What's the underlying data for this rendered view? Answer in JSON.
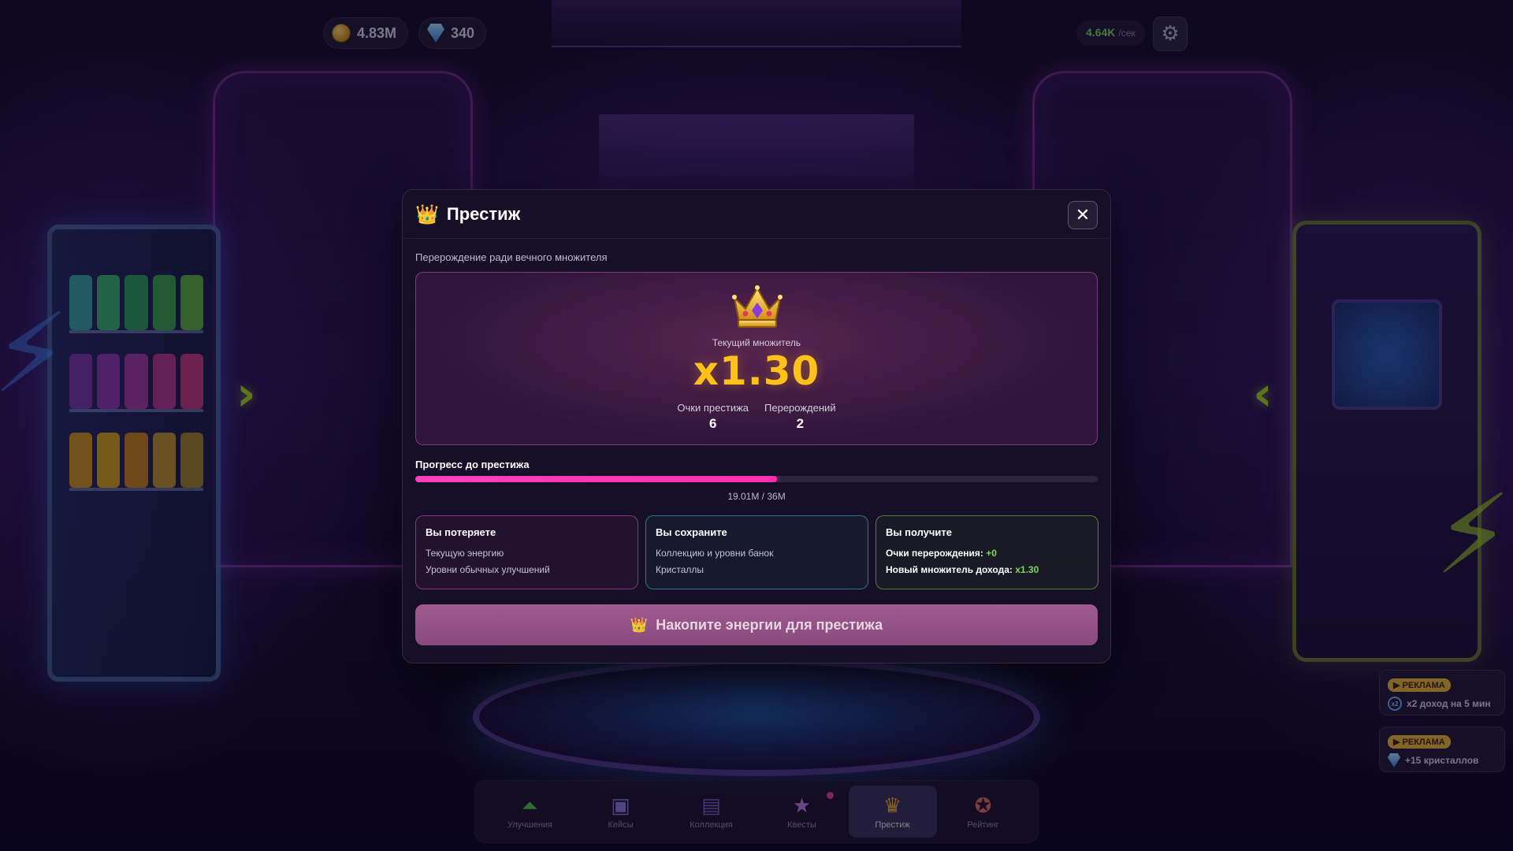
{
  "hud": {
    "coins": "4.83M",
    "crystals": "340",
    "rate_value": "4.64K",
    "rate_unit": "/сек"
  },
  "modal": {
    "title": "Престиж",
    "subtitle": "Перерождение ради вечного множителя",
    "multiplier_label": "Текущий множитель",
    "multiplier_value": "x1.30",
    "stats": [
      {
        "label": "Очки престижа",
        "value": "6"
      },
      {
        "label": "Перерождений",
        "value": "2"
      }
    ],
    "progress": {
      "title": "Прогресс до престижа",
      "text": "19.01M / 36M",
      "fraction": 0.53
    },
    "lose": {
      "title": "Вы потеряете",
      "items": [
        "Текущую энергию",
        "Уровни обычных улучшений"
      ]
    },
    "keep": {
      "title": "Вы сохраните",
      "items": [
        "Коллекцию и уровни банок",
        "Кристаллы"
      ]
    },
    "gain": {
      "title": "Вы получите",
      "points_label": "Очки перерождения:",
      "points_value": "+0",
      "mult_label": "Новый множитель дохода:",
      "mult_value": "x1.30"
    },
    "button_label": "Накопите энергии для престижа"
  },
  "ads": [
    {
      "badge": "▶ РЕКЛАМА",
      "text": "x2 доход на 5 мин",
      "icon": "x2-boost-icon"
    },
    {
      "badge": "▶ РЕКЛАМА",
      "text": "+15 кристаллов",
      "icon": "crystal-icon"
    }
  ],
  "nav": [
    {
      "label": "Улучшения",
      "icon": "upgrade-icon"
    },
    {
      "label": "Кейсы",
      "icon": "case-icon"
    },
    {
      "label": "Коллекция",
      "icon": "collection-icon"
    },
    {
      "label": "Квесты",
      "icon": "quest-star-icon"
    },
    {
      "label": "Престиж",
      "icon": "crown-icon"
    },
    {
      "label": "Рейтинг",
      "icon": "rating-medal-icon"
    }
  ],
  "colors": {
    "accent_pink": "#ff2fae",
    "gold": "#ffc21a",
    "green": "#7ed957"
  }
}
